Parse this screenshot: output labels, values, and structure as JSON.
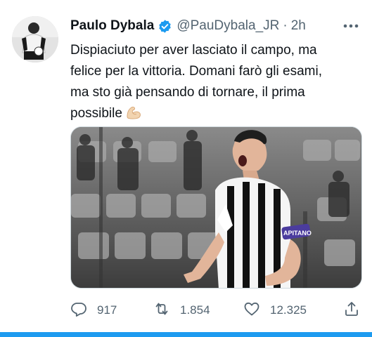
{
  "author": {
    "display_name": "Paulo Dybala",
    "handle": "@PauDybala_JR",
    "separator": "·",
    "time": "2h",
    "verified": true
  },
  "tweet": {
    "lines": [
      "Dispiaciuto per aver lasciato il campo, ma",
      "felice per la vittoria. Domani farò gli esami,",
      "ma sto già pensando di tornare, il prima",
      "possibile"
    ],
    "emoji": "flexed-biceps-icon",
    "media_caption": "APITANO"
  },
  "actions": {
    "replies": "917",
    "retweets": "1.854",
    "likes": "12.325"
  },
  "colors": {
    "accent": "#1d9bf0",
    "text": "#0f1419",
    "secondary": "#536471"
  }
}
